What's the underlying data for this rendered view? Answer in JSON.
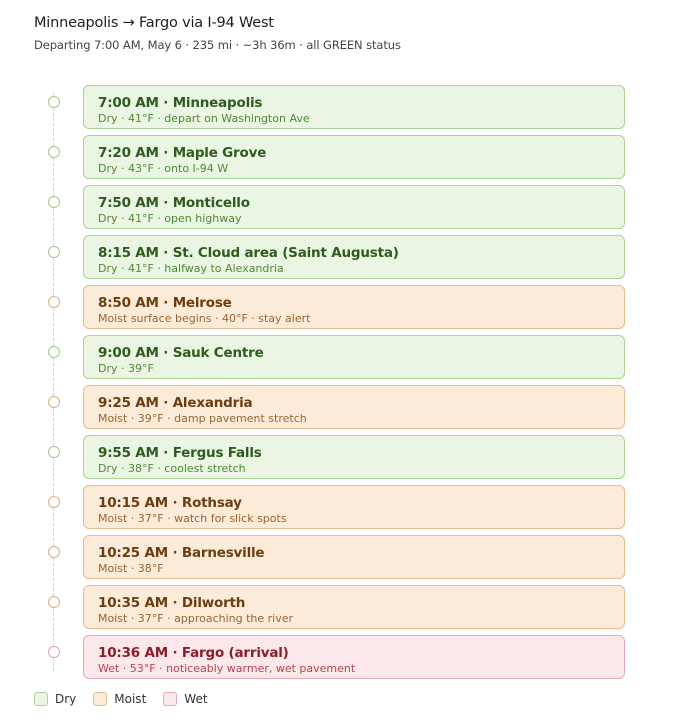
{
  "header": {
    "title": "Minneapolis → Fargo via I-94 West",
    "subtitle": "Departing 7:00 AM, May 6 · 235 mi · ~3h 36m · all GREEN status"
  },
  "colors": {
    "dry": "#a9d397",
    "moist": "#e5bd90",
    "wet": "#e8a9b2"
  },
  "stops": [
    {
      "status": "dry",
      "title": "7:00 AM · Minneapolis",
      "detail": "Dry · 41°F · depart on Washington Ave"
    },
    {
      "status": "dry",
      "title": "7:20 AM · Maple Grove",
      "detail": "Dry · 43°F · onto I-94 W"
    },
    {
      "status": "dry",
      "title": "7:50 AM · Monticello",
      "detail": "Dry · 41°F · open highway"
    },
    {
      "status": "dry",
      "title": "8:15 AM · St. Cloud area (Saint Augusta)",
      "detail": "Dry · 41°F · halfway to Alexandria"
    },
    {
      "status": "moist",
      "title": "8:50 AM · Melrose",
      "detail": "Moist surface begins · 40°F · stay alert"
    },
    {
      "status": "dry",
      "title": "9:00 AM · Sauk Centre",
      "detail": "Dry · 39°F"
    },
    {
      "status": "moist",
      "title": "9:25 AM · Alexandria",
      "detail": "Moist · 39°F · damp pavement stretch"
    },
    {
      "status": "dry",
      "title": "9:55 AM · Fergus Falls",
      "detail": "Dry · 38°F · coolest stretch"
    },
    {
      "status": "moist",
      "title": "10:15 AM · Rothsay",
      "detail": "Moist · 37°F · watch for slick spots"
    },
    {
      "status": "moist",
      "title": "10:25 AM · Barnesville",
      "detail": "Moist · 38°F"
    },
    {
      "status": "moist",
      "title": "10:35 AM · Dilworth",
      "detail": "Moist · 37°F · approaching the river"
    },
    {
      "status": "wet",
      "title": "10:36 AM · Fargo (arrival)",
      "detail": "Wet · 53°F · noticeably warmer, wet pavement"
    }
  ],
  "legend": [
    {
      "status": "dry",
      "label": "Dry"
    },
    {
      "status": "moist",
      "label": "Moist"
    },
    {
      "status": "wet",
      "label": "Wet"
    }
  ]
}
